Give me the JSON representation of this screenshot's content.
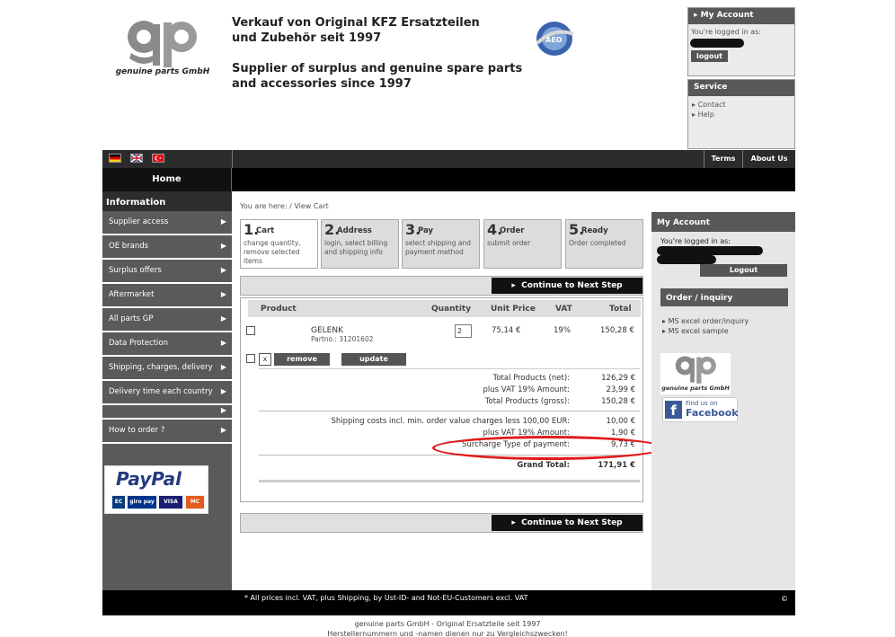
{
  "header": {
    "logo_text": "genuine parts GmbH",
    "tagline_de_1": "Verkauf von Original KFZ Ersatzteilen",
    "tagline_de_2": "und Zubehör seit 1997",
    "tagline_en_1": "Supplier of surplus and genuine spare parts",
    "tagline_en_2": "and accessories since 1997"
  },
  "my_account_box": {
    "title": "My Account",
    "logged_in_label": "You're logged in as:",
    "logout_label": "logout"
  },
  "service_box": {
    "title": "Service",
    "items": [
      "Contact",
      "Help"
    ]
  },
  "topnav": {
    "terms": "Terms",
    "about": "About Us"
  },
  "home_tab": "Home",
  "sidebar": {
    "heading": "Information",
    "items": [
      {
        "label": "Supplier access"
      },
      {
        "label": "OE brands"
      },
      {
        "label": "Surplus offers"
      },
      {
        "label": "Aftermarket"
      },
      {
        "label": "All parts GP"
      },
      {
        "label": "Data Protection"
      },
      {
        "label": "Shipping, charges, delivery"
      },
      {
        "label": "Delivery time each country"
      },
      {
        "label": ""
      },
      {
        "label": "How to order ?"
      }
    ],
    "paypal_text": "PayPal",
    "cards": [
      "EC",
      "giro pay",
      "VISA",
      "MC"
    ]
  },
  "breadcrumb": "You are here: / View Cart",
  "steps": [
    {
      "num": "1.",
      "title": "Cart",
      "sub": "change quantity, remove selected items"
    },
    {
      "num": "2.",
      "title": "Address",
      "sub": "login, select billing and shipping info"
    },
    {
      "num": "3.",
      "title": "Pay",
      "sub": "select shipping and payment method"
    },
    {
      "num": "4.",
      "title": "Order",
      "sub": "submit order"
    },
    {
      "num": "5.",
      "title": "Ready",
      "sub": "Order completed"
    }
  ],
  "continue_label": "Continue to Next Step",
  "cart": {
    "headers": {
      "product": "Product",
      "quantity": "Quantity",
      "unit_price": "Unit Price",
      "vat": "VAT",
      "total": "Total"
    },
    "item": {
      "name": "GELENK",
      "partno": "Partno.: 31201602",
      "qty": "2",
      "unit_price": "75,14 €",
      "vat": "19%",
      "total": "150,28 €"
    },
    "x_label": "x",
    "remove_label": "remove",
    "update_label": "update",
    "summary": [
      {
        "label": "Total Products (net):",
        "value": "126,29 €"
      },
      {
        "label": "plus VAT 19% Amount:",
        "value": "23,99 €"
      },
      {
        "label": "Total Products (gross):",
        "value": "150,28 €"
      }
    ],
    "shipping": [
      {
        "label": "Shipping costs incl. min. order value charges less 100,00 EUR:",
        "value": "10,00 €"
      },
      {
        "label": "plus VAT 19% Amount:",
        "value": "1,90 €"
      },
      {
        "label": "Surcharge Type of payment:",
        "value": "9,73 €"
      }
    ],
    "grand_total_label": "Grand Total:",
    "grand_total_value": "171,91 €"
  },
  "right_col": {
    "title": "My Account",
    "logged_in_label": "You're logged in as:",
    "logout_label": "Logout",
    "order_title": "Order / inquiry",
    "links": [
      "MS excel order/inquiry",
      "MS excel sample"
    ],
    "logo_text": "genuine parts GmbH",
    "fb_line1": "Find us on",
    "fb_line2": "Facebook"
  },
  "footer": {
    "note": "* All prices incl. VAT, plus Shipping, by Ust-ID- and Not-EU-Customers excl. VAT",
    "copyright": "©",
    "line1": "genuine parts GmbH - Original Ersatzteile seit 1997",
    "line2": "Herstellernummern und -namen dienen nur zu Vergleichszwecken!"
  },
  "colors": {
    "dark": "#2b2b2b",
    "sidebar": "#5a5a5c",
    "highlight": "#e01b1b"
  }
}
